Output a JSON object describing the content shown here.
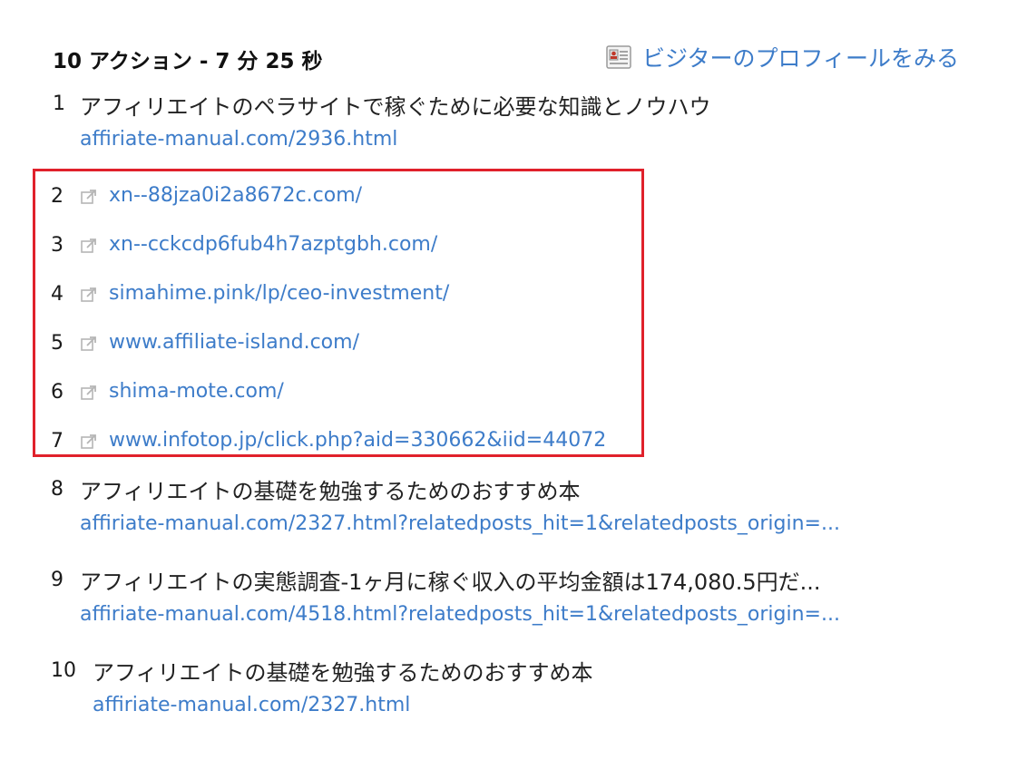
{
  "header": {
    "title": "10 アクション - 7 分 25 秒",
    "profile_link": "ビジターのプロフィールをみる"
  },
  "actions": [
    {
      "num": "1",
      "title": "アフィリエイトのペラサイトで稼ぐために必要な知識とノウハウ",
      "url": "affiriate-manual.com/2936.html"
    },
    {
      "num": "2",
      "url": "xn--88jza0i2a8672c.com/",
      "icon": "external-link-icon"
    },
    {
      "num": "3",
      "url": "xn--cckcdp6fub4h7azptgbh.com/",
      "icon": "external-link-icon"
    },
    {
      "num": "4",
      "url": "simahime.pink/lp/ceo-investment/",
      "icon": "external-link-icon"
    },
    {
      "num": "5",
      "url": "www.affiliate-island.com/",
      "icon": "external-link-icon"
    },
    {
      "num": "6",
      "url": "shima-mote.com/",
      "icon": "external-link-icon"
    },
    {
      "num": "7",
      "url": "www.infotop.jp/click.php?aid=330662&iid=44072",
      "icon": "external-link-icon"
    },
    {
      "num": "8",
      "title": "アフィリエイトの基礎を勉強するためのおすすめ本",
      "url": "affiriate-manual.com/2327.html?relatedposts_hit=1&relatedposts_origin=..."
    },
    {
      "num": "9",
      "title": "アフィリエイトの実態調査-1ヶ月に稼ぐ収入の平均金額は174,080.5円だ...",
      "url": "affiriate-manual.com/4518.html?relatedposts_hit=1&relatedposts_origin=..."
    },
    {
      "num": "10",
      "title": "アフィリエイトの基礎を勉強するためのおすすめ本",
      "url": "affiriate-manual.com/2327.html"
    }
  ],
  "colors": {
    "link": "#3d7cc9",
    "highlight": "#e0212b"
  }
}
